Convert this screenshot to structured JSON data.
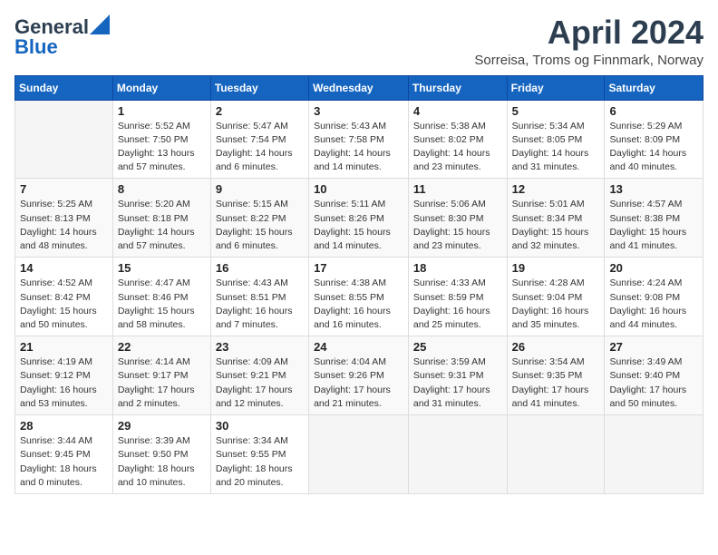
{
  "header": {
    "logo_general": "General",
    "logo_blue": "Blue",
    "month_title": "April 2024",
    "location": "Sorreisa, Troms og Finnmark, Norway"
  },
  "days_of_week": [
    "Sunday",
    "Monday",
    "Tuesday",
    "Wednesday",
    "Thursday",
    "Friday",
    "Saturday"
  ],
  "weeks": [
    [
      {
        "day": "",
        "info": ""
      },
      {
        "day": "1",
        "info": "Sunrise: 5:52 AM\nSunset: 7:50 PM\nDaylight: 13 hours\nand 57 minutes."
      },
      {
        "day": "2",
        "info": "Sunrise: 5:47 AM\nSunset: 7:54 PM\nDaylight: 14 hours\nand 6 minutes."
      },
      {
        "day": "3",
        "info": "Sunrise: 5:43 AM\nSunset: 7:58 PM\nDaylight: 14 hours\nand 14 minutes."
      },
      {
        "day": "4",
        "info": "Sunrise: 5:38 AM\nSunset: 8:02 PM\nDaylight: 14 hours\nand 23 minutes."
      },
      {
        "day": "5",
        "info": "Sunrise: 5:34 AM\nSunset: 8:05 PM\nDaylight: 14 hours\nand 31 minutes."
      },
      {
        "day": "6",
        "info": "Sunrise: 5:29 AM\nSunset: 8:09 PM\nDaylight: 14 hours\nand 40 minutes."
      }
    ],
    [
      {
        "day": "7",
        "info": "Sunrise: 5:25 AM\nSunset: 8:13 PM\nDaylight: 14 hours\nand 48 minutes."
      },
      {
        "day": "8",
        "info": "Sunrise: 5:20 AM\nSunset: 8:18 PM\nDaylight: 14 hours\nand 57 minutes."
      },
      {
        "day": "9",
        "info": "Sunrise: 5:15 AM\nSunset: 8:22 PM\nDaylight: 15 hours\nand 6 minutes."
      },
      {
        "day": "10",
        "info": "Sunrise: 5:11 AM\nSunset: 8:26 PM\nDaylight: 15 hours\nand 14 minutes."
      },
      {
        "day": "11",
        "info": "Sunrise: 5:06 AM\nSunset: 8:30 PM\nDaylight: 15 hours\nand 23 minutes."
      },
      {
        "day": "12",
        "info": "Sunrise: 5:01 AM\nSunset: 8:34 PM\nDaylight: 15 hours\nand 32 minutes."
      },
      {
        "day": "13",
        "info": "Sunrise: 4:57 AM\nSunset: 8:38 PM\nDaylight: 15 hours\nand 41 minutes."
      }
    ],
    [
      {
        "day": "14",
        "info": "Sunrise: 4:52 AM\nSunset: 8:42 PM\nDaylight: 15 hours\nand 50 minutes."
      },
      {
        "day": "15",
        "info": "Sunrise: 4:47 AM\nSunset: 8:46 PM\nDaylight: 15 hours\nand 58 minutes."
      },
      {
        "day": "16",
        "info": "Sunrise: 4:43 AM\nSunset: 8:51 PM\nDaylight: 16 hours\nand 7 minutes."
      },
      {
        "day": "17",
        "info": "Sunrise: 4:38 AM\nSunset: 8:55 PM\nDaylight: 16 hours\nand 16 minutes."
      },
      {
        "day": "18",
        "info": "Sunrise: 4:33 AM\nSunset: 8:59 PM\nDaylight: 16 hours\nand 25 minutes."
      },
      {
        "day": "19",
        "info": "Sunrise: 4:28 AM\nSunset: 9:04 PM\nDaylight: 16 hours\nand 35 minutes."
      },
      {
        "day": "20",
        "info": "Sunrise: 4:24 AM\nSunset: 9:08 PM\nDaylight: 16 hours\nand 44 minutes."
      }
    ],
    [
      {
        "day": "21",
        "info": "Sunrise: 4:19 AM\nSunset: 9:12 PM\nDaylight: 16 hours\nand 53 minutes."
      },
      {
        "day": "22",
        "info": "Sunrise: 4:14 AM\nSunset: 9:17 PM\nDaylight: 17 hours\nand 2 minutes."
      },
      {
        "day": "23",
        "info": "Sunrise: 4:09 AM\nSunset: 9:21 PM\nDaylight: 17 hours\nand 12 minutes."
      },
      {
        "day": "24",
        "info": "Sunrise: 4:04 AM\nSunset: 9:26 PM\nDaylight: 17 hours\nand 21 minutes."
      },
      {
        "day": "25",
        "info": "Sunrise: 3:59 AM\nSunset: 9:31 PM\nDaylight: 17 hours\nand 31 minutes."
      },
      {
        "day": "26",
        "info": "Sunrise: 3:54 AM\nSunset: 9:35 PM\nDaylight: 17 hours\nand 41 minutes."
      },
      {
        "day": "27",
        "info": "Sunrise: 3:49 AM\nSunset: 9:40 PM\nDaylight: 17 hours\nand 50 minutes."
      }
    ],
    [
      {
        "day": "28",
        "info": "Sunrise: 3:44 AM\nSunset: 9:45 PM\nDaylight: 18 hours\nand 0 minutes."
      },
      {
        "day": "29",
        "info": "Sunrise: 3:39 AM\nSunset: 9:50 PM\nDaylight: 18 hours\nand 10 minutes."
      },
      {
        "day": "30",
        "info": "Sunrise: 3:34 AM\nSunset: 9:55 PM\nDaylight: 18 hours\nand 20 minutes."
      },
      {
        "day": "",
        "info": ""
      },
      {
        "day": "",
        "info": ""
      },
      {
        "day": "",
        "info": ""
      },
      {
        "day": "",
        "info": ""
      }
    ]
  ]
}
